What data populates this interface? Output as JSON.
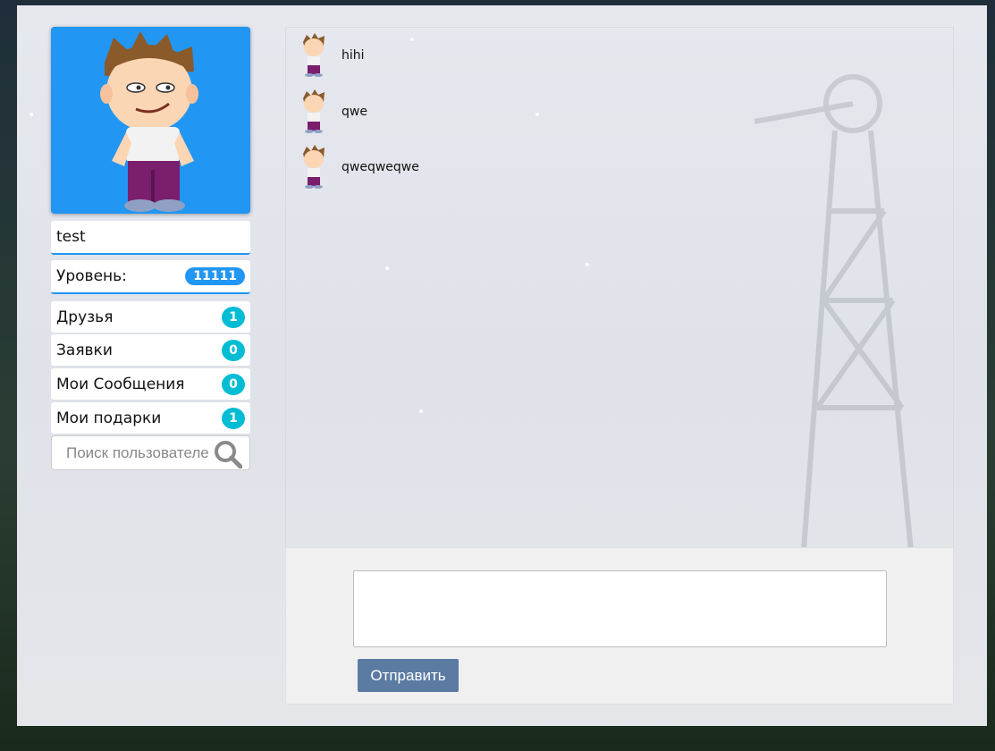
{
  "profile": {
    "username": "test",
    "level_label": "Уровень:",
    "level_value": "11111"
  },
  "menu": [
    {
      "label": "Друзья",
      "count": "1"
    },
    {
      "label": "Заявки",
      "count": "0"
    },
    {
      "label": "Мои Сообщения",
      "count": "0"
    },
    {
      "label": "Мои подарки",
      "count": "1"
    }
  ],
  "search": {
    "placeholder": "Поиск пользователей",
    "icon": "search-icon"
  },
  "messages": [
    {
      "text": "hihi"
    },
    {
      "text": "qwe"
    },
    {
      "text": "qweqweqwe"
    }
  ],
  "compose": {
    "send_label": "Отправить"
  },
  "colors": {
    "accent": "#2196f3",
    "count_badge": "#00bcd4",
    "send_button": "#5b7ba3"
  }
}
